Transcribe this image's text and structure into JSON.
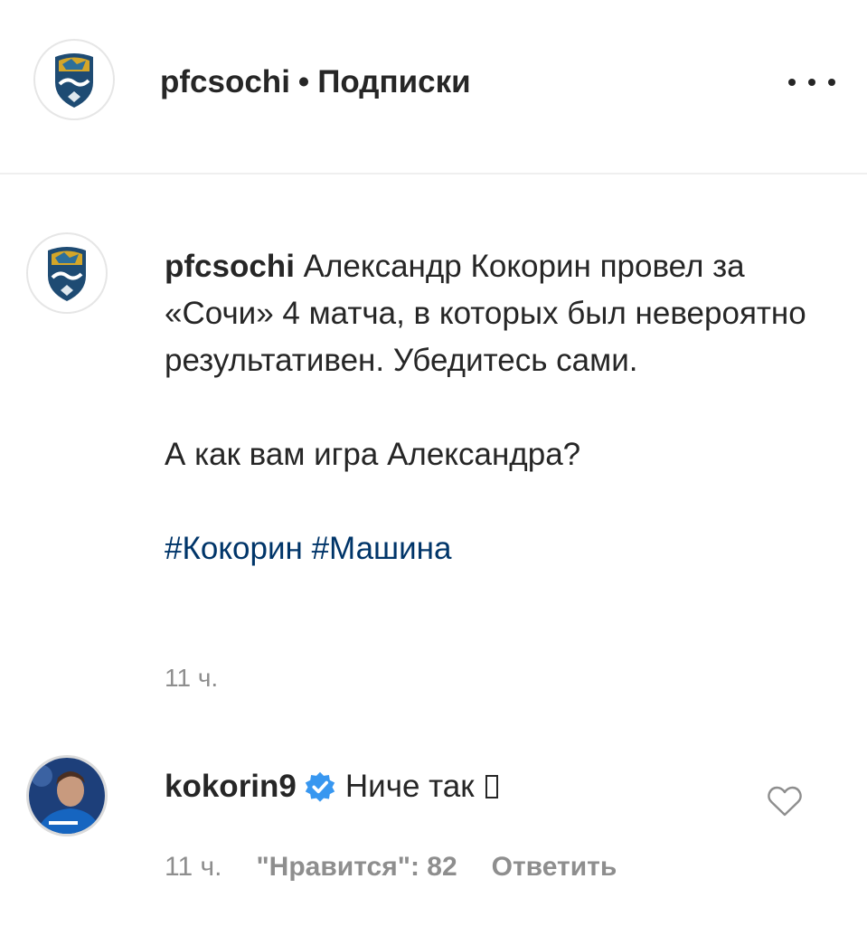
{
  "header": {
    "username": "pfcsochi",
    "separator": "•",
    "follow_label": "Подписки"
  },
  "caption": {
    "username": "pfcsochi",
    "text_line1": "Александр Кокорин провел за «Сочи» 4 матча, в которых был невероятно результативен. Убедитесь сами.",
    "text_line2": "А как вам игра Александра?",
    "hashtags": [
      "#Кокорин",
      "#Машина"
    ],
    "time": "11 ч."
  },
  "comment": {
    "username": "kokorin9",
    "verified": true,
    "text": "Ниче так",
    "time": "11 ч.",
    "likes_label": "\"Нравится\": 82",
    "reply_label": "Ответить"
  },
  "colors": {
    "text": "#262626",
    "secondary": "#8e8e8e",
    "hashtag": "#003569",
    "verified": "#3897f0",
    "divider": "#efefef"
  },
  "icons": {
    "more": "more-horizontal-icon",
    "verified": "verified-badge-icon",
    "heart": "heart-outline-icon"
  }
}
